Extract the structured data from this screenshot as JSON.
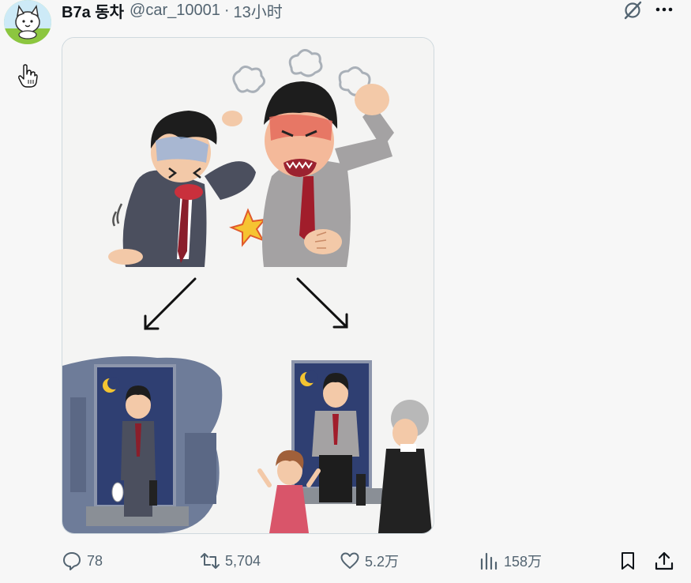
{
  "post": {
    "display_name": "B7a 동차",
    "handle": "@car_10001",
    "separator": "·",
    "time": "13小时"
  },
  "icons": {
    "avatar": "cat-avatar-icon",
    "cursor": "hand-pointer-icon",
    "grok": "grok-icon",
    "more": "more-icon",
    "reply": "reply-icon",
    "repost": "repost-icon",
    "like": "like-icon",
    "views": "views-icon",
    "bookmark": "bookmark-icon",
    "share": "share-icon"
  },
  "metrics": {
    "replies": "78",
    "reposts": "5,704",
    "likes": "5.2万",
    "views": "158万"
  },
  "colors": {
    "text_primary": "#0f1419",
    "text_secondary": "#536471",
    "background": "#f7f7f7",
    "border": "#cfd9de"
  }
}
